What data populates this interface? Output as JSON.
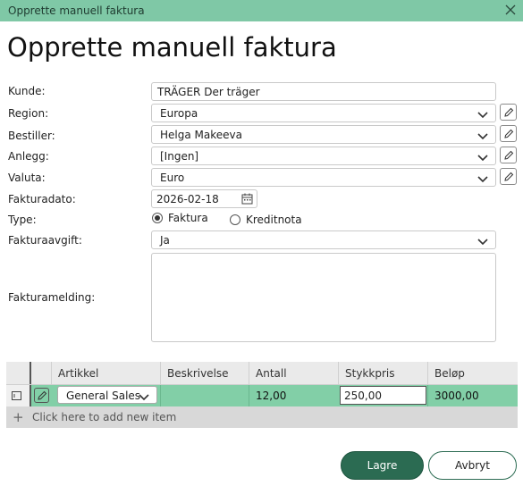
{
  "window": {
    "title": "Opprette manuell faktura"
  },
  "page": {
    "heading": "Opprette manuell faktura"
  },
  "form": {
    "kunde_label": "Kunde:",
    "kunde_value": "TRÄGER Der träger",
    "region_label": "Region:",
    "region_value": "Europa",
    "bestiller_label": "Bestiller:",
    "bestiller_value": "Helga Makeeva",
    "anlegg_label": "Anlegg:",
    "anlegg_value": "[Ingen]",
    "valuta_label": "Valuta:",
    "valuta_value": "Euro",
    "fakturadato_label": "Fakturadato:",
    "fakturadato_value": "2026-02-18",
    "type_label": "Type:",
    "type_options": [
      "Faktura",
      "Kreditnota"
    ],
    "type_selected": "Faktura",
    "fakturaavgift_label": "Fakturaavgift:",
    "fakturaavgift_value": "Ja",
    "fakturamelding_label": "Fakturamelding:",
    "fakturamelding_value": ""
  },
  "grid": {
    "columns": [
      "Artikkel",
      "Beskrivelse",
      "Antall",
      "Stykkpris",
      "Beløp"
    ],
    "rows": [
      {
        "artikkel": "General Sales",
        "beskrivelse": "",
        "antall": "12,00",
        "stykkpris": "250,00",
        "belop": "3000,00"
      }
    ],
    "add_item": "Click here to add new item"
  },
  "buttons": {
    "save": "Lagre",
    "cancel": "Avbryt"
  },
  "colors": {
    "titlebar": "#7fc8a6",
    "selected_row": "#82cfa7",
    "primary": "#2b6b52"
  }
}
